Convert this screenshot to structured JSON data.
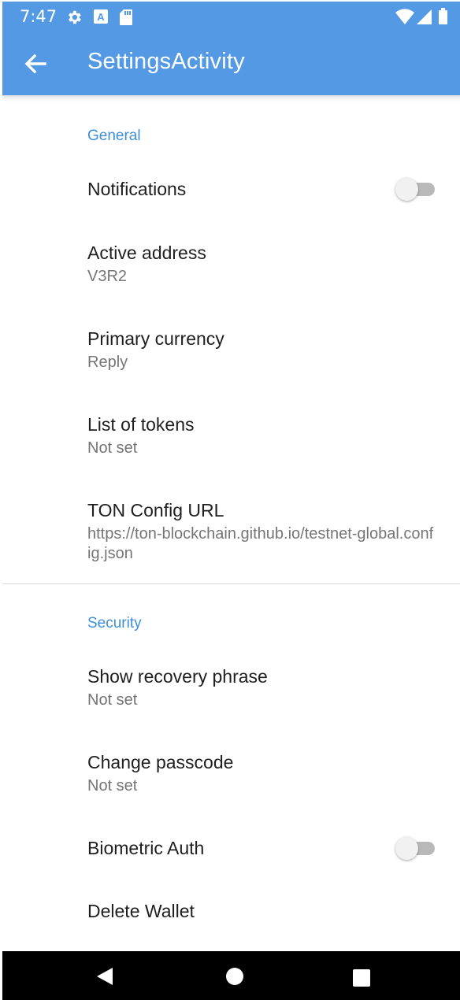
{
  "status_bar": {
    "time": "7:47",
    "left_icons": [
      "gear-icon",
      "a-badge-icon",
      "sd-card-icon"
    ],
    "right_icons": [
      "wifi-icon",
      "signal-icon",
      "battery-icon"
    ]
  },
  "app_bar": {
    "title": "SettingsActivity",
    "back_icon": "arrow-back-icon",
    "color": "#5399e3"
  },
  "sections": {
    "general": {
      "header": "General",
      "notifications": {
        "title": "Notifications",
        "enabled": false
      },
      "active_address": {
        "title": "Active address",
        "summary": "V3R2"
      },
      "primary_currency": {
        "title": "Primary currency",
        "summary": "Reply"
      },
      "list_of_tokens": {
        "title": "List of tokens",
        "summary": "Not set"
      },
      "ton_config_url": {
        "title": "TON Config URL",
        "summary": "https://ton-blockchain.github.io/testnet-global.config.json"
      }
    },
    "security": {
      "header": "Security",
      "show_recovery_phrase": {
        "title": "Show recovery phrase",
        "summary": "Not set"
      },
      "change_passcode": {
        "title": "Change passcode",
        "summary": "Not set"
      },
      "biometric_auth": {
        "title": "Biometric Auth",
        "enabled": false
      },
      "delete_wallet": {
        "title": "Delete Wallet"
      }
    }
  },
  "nav_bar": {
    "buttons": [
      "back-triangle-icon",
      "home-circle-icon",
      "recents-square-icon"
    ]
  },
  "colors": {
    "accent": "#3c8fdb",
    "primary": "#5399e3",
    "title_text": "#1f1f1f",
    "summary_text": "#757575"
  }
}
